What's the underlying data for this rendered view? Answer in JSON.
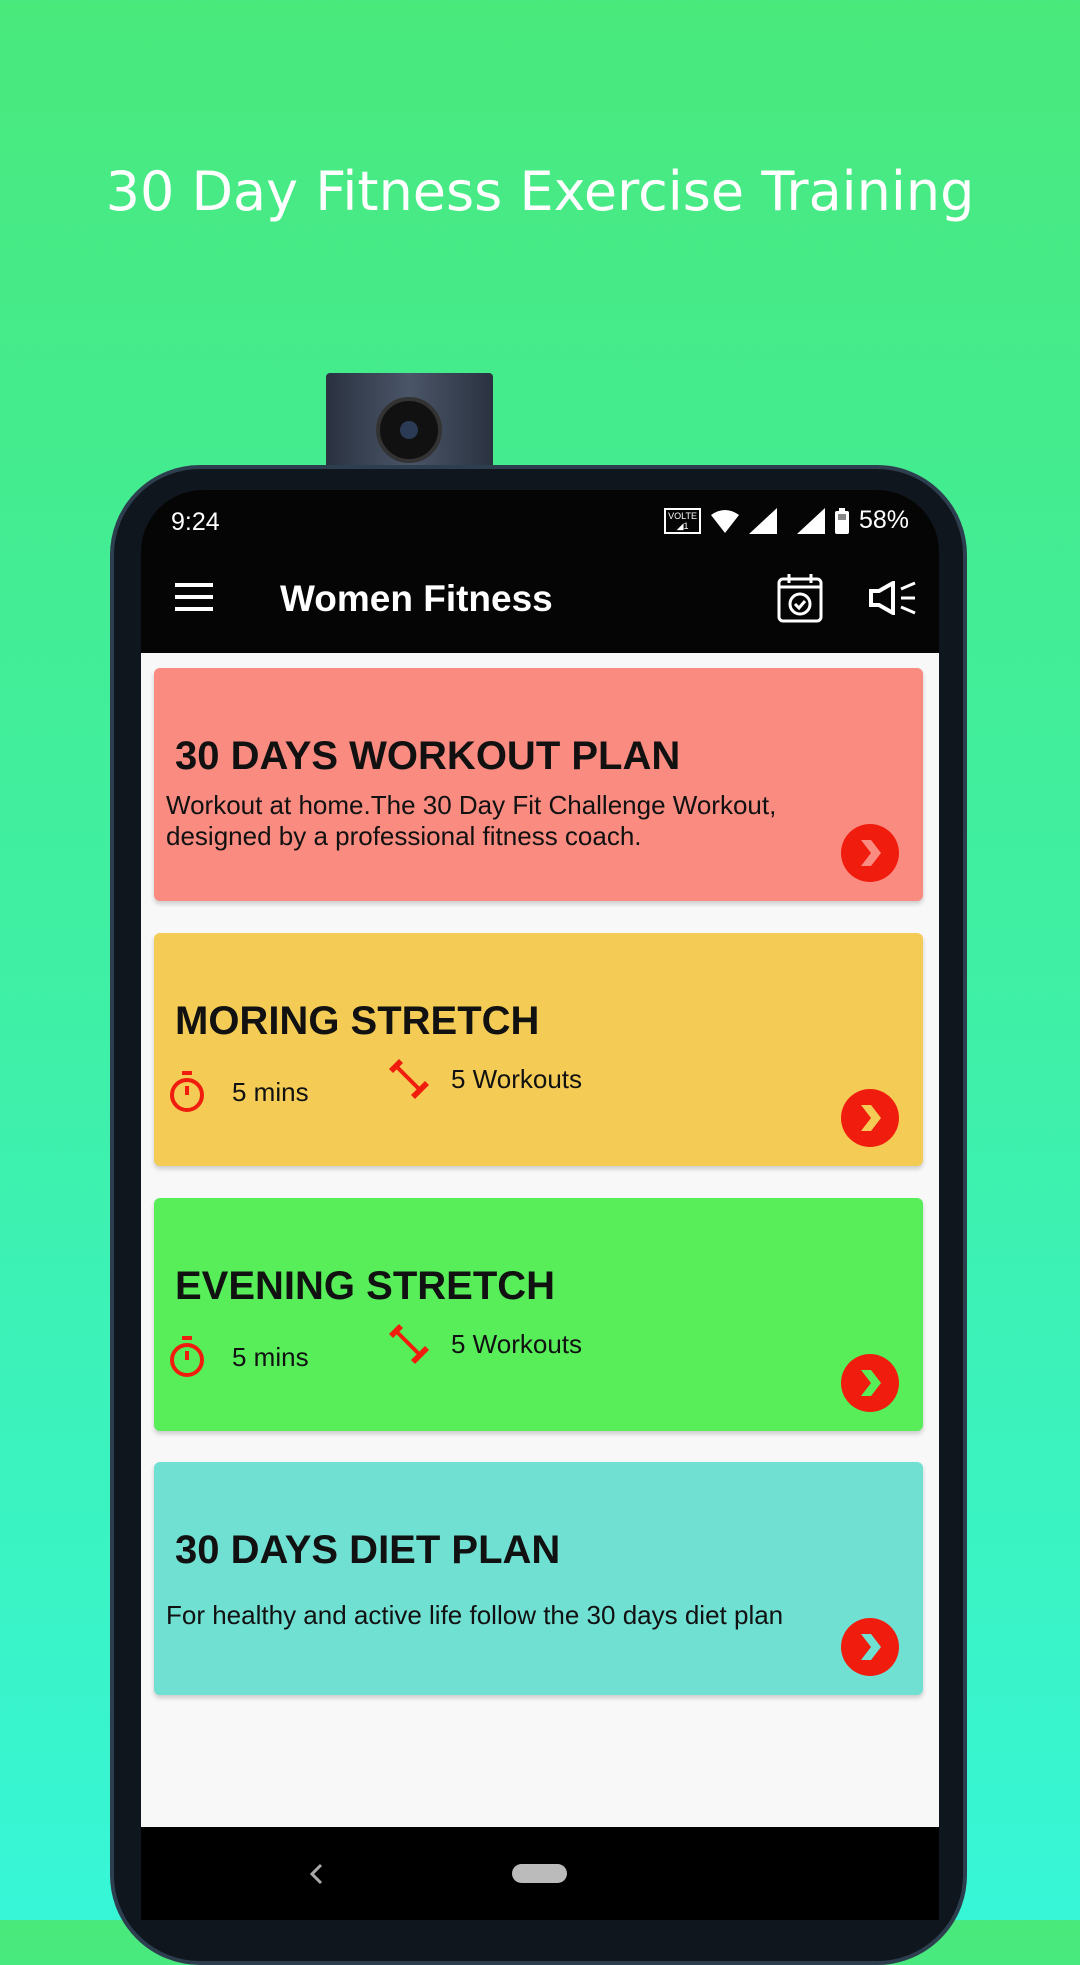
{
  "headline": "30 Day Fitness Exercise Training",
  "status": {
    "time": "9:24",
    "volte": "VOLTE",
    "battery": "58%"
  },
  "appbar": {
    "title": "Women Fitness",
    "icons": [
      "menu-icon",
      "calendar-check-icon",
      "megaphone-icon"
    ]
  },
  "cards": [
    {
      "title": "30 DAYS WORKOUT PLAN",
      "description": "Workout at home.The 30 Day Fit Challenge Workout, designed by a professional fitness coach.",
      "color": "#f98b80"
    },
    {
      "title": "MORING STRETCH",
      "duration": "5 mins",
      "workouts": "5 Workouts",
      "color": "#f4cc55"
    },
    {
      "title": "EVENING STRETCH",
      "duration": "5 mins",
      "workouts": "5 Workouts",
      "color": "#57ee5a"
    },
    {
      "title": "30 DAYS DIET PLAN",
      "description": "For healthy and active life follow the 30 days diet plan",
      "color": "#70e0d3"
    }
  ],
  "colors": {
    "accent": "#f01d0f",
    "background_top": "#49e97c",
    "background_bottom": "#37f6d8"
  }
}
